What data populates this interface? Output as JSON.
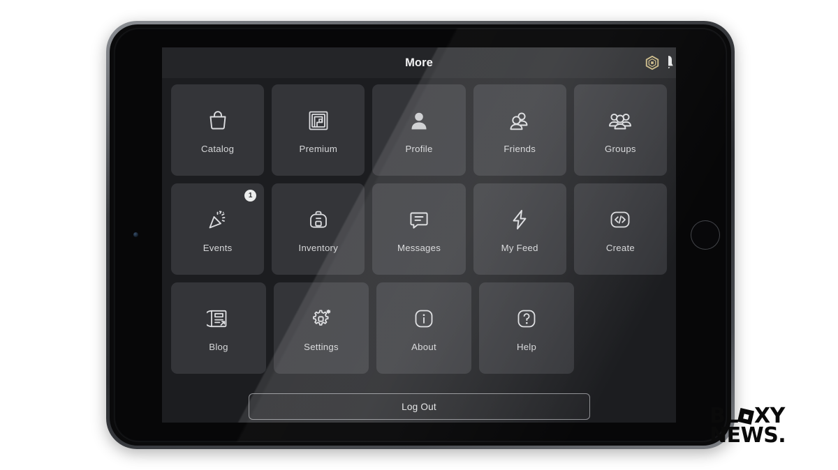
{
  "app": {
    "title": "More",
    "robux_icon": "robux-hexagon-icon",
    "notification_icon": "notification-bell-icon"
  },
  "colors": {
    "screen_bg": "#1c1d20",
    "header_bg": "#242528",
    "tile_bg": "#343539",
    "tile_label": "#d6d7d9",
    "title_text": "#f2f2f3",
    "robux_gold": "#c9b782",
    "badge_bg": "#eceded",
    "logout_border": "#8f9094",
    "tablet_frame": "#6e7176",
    "watermark": "#0a0a0a"
  },
  "grid": {
    "rows": [
      [
        {
          "label": "Catalog",
          "icon": "shopping-bag-icon",
          "badge": null,
          "highlighted": false
        },
        {
          "label": "Premium",
          "icon": "premium-spiral-icon",
          "badge": null,
          "highlighted": false
        },
        {
          "label": "Profile",
          "icon": "person-icon",
          "badge": null,
          "highlighted": false
        },
        {
          "label": "Friends",
          "icon": "friends-icon",
          "badge": null,
          "highlighted": true
        },
        {
          "label": "Groups",
          "icon": "groups-icon",
          "badge": null,
          "highlighted": true
        }
      ],
      [
        {
          "label": "Events",
          "icon": "party-popper-icon",
          "badge": "1",
          "highlighted": false
        },
        {
          "label": "Inventory",
          "icon": "backpack-icon",
          "badge": null,
          "highlighted": false
        },
        {
          "label": "Messages",
          "icon": "message-icon",
          "badge": null,
          "highlighted": false
        },
        {
          "label": "My Feed",
          "icon": "lightning-bolt-icon",
          "badge": null,
          "highlighted": false
        },
        {
          "label": "Create",
          "icon": "code-brackets-icon",
          "badge": null,
          "highlighted": true
        }
      ],
      [
        {
          "label": "Blog",
          "icon": "blog-document-icon",
          "badge": null,
          "highlighted": false
        },
        {
          "label": "Settings",
          "icon": "gear-sparkle-icon",
          "badge": null,
          "highlighted": false
        },
        {
          "label": "About",
          "icon": "info-icon",
          "badge": null,
          "highlighted": false
        },
        {
          "label": "Help",
          "icon": "question-mark-icon",
          "badge": null,
          "highlighted": false
        }
      ]
    ]
  },
  "logout": {
    "label": "Log Out"
  },
  "watermark": {
    "line1_a": "BL",
    "line1_b": "XY",
    "line2": "NEWS."
  }
}
